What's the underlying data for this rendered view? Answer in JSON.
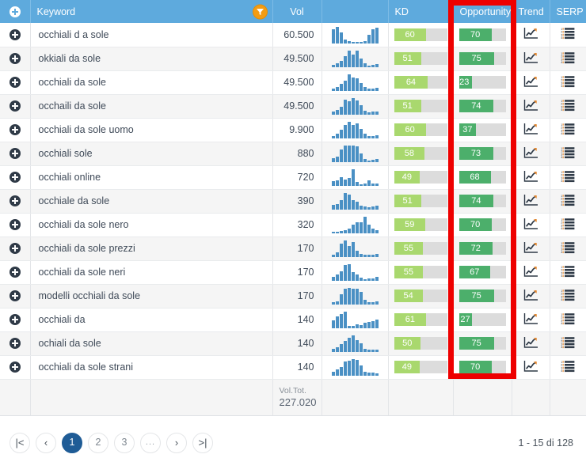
{
  "table": {
    "columns": [
      {
        "key": "add",
        "label": "",
        "icon": "plus-circle-icon"
      },
      {
        "key": "kw",
        "label": "Keyword",
        "icon": "filter-funnel-icon"
      },
      {
        "key": "vol",
        "label": "Vol"
      },
      {
        "key": "spark",
        "label": ""
      },
      {
        "key": "kd",
        "label": "KD"
      },
      {
        "key": "opp",
        "label": "Opportunity"
      },
      {
        "key": "trend",
        "label": "Trend"
      },
      {
        "key": "serp",
        "label": "SERP"
      }
    ],
    "rows": [
      {
        "keyword": "occhiali d a sole",
        "vol": "60.500",
        "kd": 60,
        "opp": 70,
        "spark": [
          78,
          92,
          62,
          20,
          14,
          10,
          9,
          9,
          12,
          48,
          80,
          86
        ]
      },
      {
        "keyword": "okkiali da sole",
        "vol": "49.500",
        "kd": 51,
        "opp": 75,
        "spark": [
          14,
          22,
          36,
          62,
          90,
          70,
          88,
          46,
          22,
          10,
          12,
          16
        ]
      },
      {
        "keyword": "occhiali da sole",
        "vol": "49.500",
        "kd": 64,
        "opp": 23,
        "spark": [
          14,
          24,
          38,
          58,
          92,
          74,
          72,
          44,
          24,
          12,
          14,
          16
        ]
      },
      {
        "keyword": "occhaili da sole",
        "vol": "49.500",
        "kd": 51,
        "opp": 74,
        "spark": [
          14,
          24,
          40,
          76,
          66,
          84,
          70,
          46,
          20,
          12,
          14,
          16
        ]
      },
      {
        "keyword": "occhiali da sole uomo",
        "vol": "9.900",
        "kd": 60,
        "opp": 37,
        "spark": [
          12,
          26,
          44,
          72,
          88,
          70,
          78,
          52,
          24,
          14,
          12,
          18
        ]
      },
      {
        "keyword": "occhiali sole",
        "vol": "880",
        "kd": 58,
        "opp": 73,
        "spark": [
          20,
          30,
          66,
          86,
          88,
          86,
          84,
          44,
          18,
          10,
          14,
          18
        ]
      },
      {
        "keyword": "occhiali online",
        "vol": "720",
        "kd": 49,
        "opp": 68,
        "spark": [
          24,
          26,
          44,
          32,
          40,
          84,
          18,
          8,
          10,
          28,
          10,
          12
        ]
      },
      {
        "keyword": "occhiale da sole",
        "vol": "390",
        "kd": 51,
        "opp": 74,
        "spark": [
          22,
          28,
          46,
          84,
          76,
          48,
          38,
          20,
          14,
          10,
          16,
          18
        ]
      },
      {
        "keyword": "occhiali da sole nero",
        "vol": "320",
        "kd": 59,
        "opp": 70,
        "spark": [
          8,
          8,
          10,
          14,
          24,
          42,
          56,
          54,
          82,
          44,
          22,
          14
        ]
      },
      {
        "keyword": "occhiali da sole prezzi",
        "vol": "170",
        "kd": 55,
        "opp": 72,
        "spark": [
          10,
          24,
          62,
          78,
          52,
          70,
          30,
          14,
          12,
          10,
          10,
          14
        ]
      },
      {
        "keyword": "occhiali da sole neri",
        "vol": "170",
        "kd": 55,
        "opp": 67,
        "spark": [
          22,
          36,
          52,
          86,
          92,
          48,
          36,
          18,
          10,
          12,
          14,
          22
        ]
      },
      {
        "keyword": "modelli occhiali da sole",
        "vol": "170",
        "kd": 54,
        "opp": 75,
        "spark": [
          12,
          16,
          48,
          76,
          78,
          74,
          74,
          58,
          22,
          10,
          10,
          14
        ]
      },
      {
        "keyword": "occhiali da",
        "vol": "140",
        "kd": 61,
        "opp": 27,
        "spark": [
          34,
          50,
          62,
          72,
          10,
          10,
          18,
          12,
          24,
          26,
          30,
          36
        ]
      },
      {
        "keyword": "ochiali da sole",
        "vol": "140",
        "kd": 50,
        "opp": 75,
        "spark": [
          18,
          24,
          40,
          58,
          72,
          86,
          60,
          44,
          18,
          12,
          12,
          14
        ]
      },
      {
        "keyword": "occhiali da sole strani",
        "vol": "140",
        "kd": 49,
        "opp": 70,
        "spark": [
          18,
          30,
          42,
          70,
          74,
          80,
          78,
          48,
          20,
          16,
          14,
          10
        ]
      }
    ],
    "total": {
      "label": "Vol.Tot.",
      "value": "227.020"
    }
  },
  "pagination": {
    "first": "|<",
    "prev": "‹",
    "pages": [
      "1",
      "2",
      "3"
    ],
    "ellipsis": "...",
    "next": "›",
    "last": ">|",
    "active_page": "1",
    "range_text": "1 - 15 di 128"
  },
  "annotation": {
    "highlight_column": "Opportunity",
    "color": "#ee0000"
  },
  "colors": {
    "header_bg": "#5eaadd",
    "kd_fill": "#a9d86e",
    "opp_fill": "#4caf6b",
    "bar_track": "#dcdcdc",
    "spark_bar": "#4a90c4",
    "pager_active": "#1f5c96",
    "filter_icon": "#f39c12"
  }
}
